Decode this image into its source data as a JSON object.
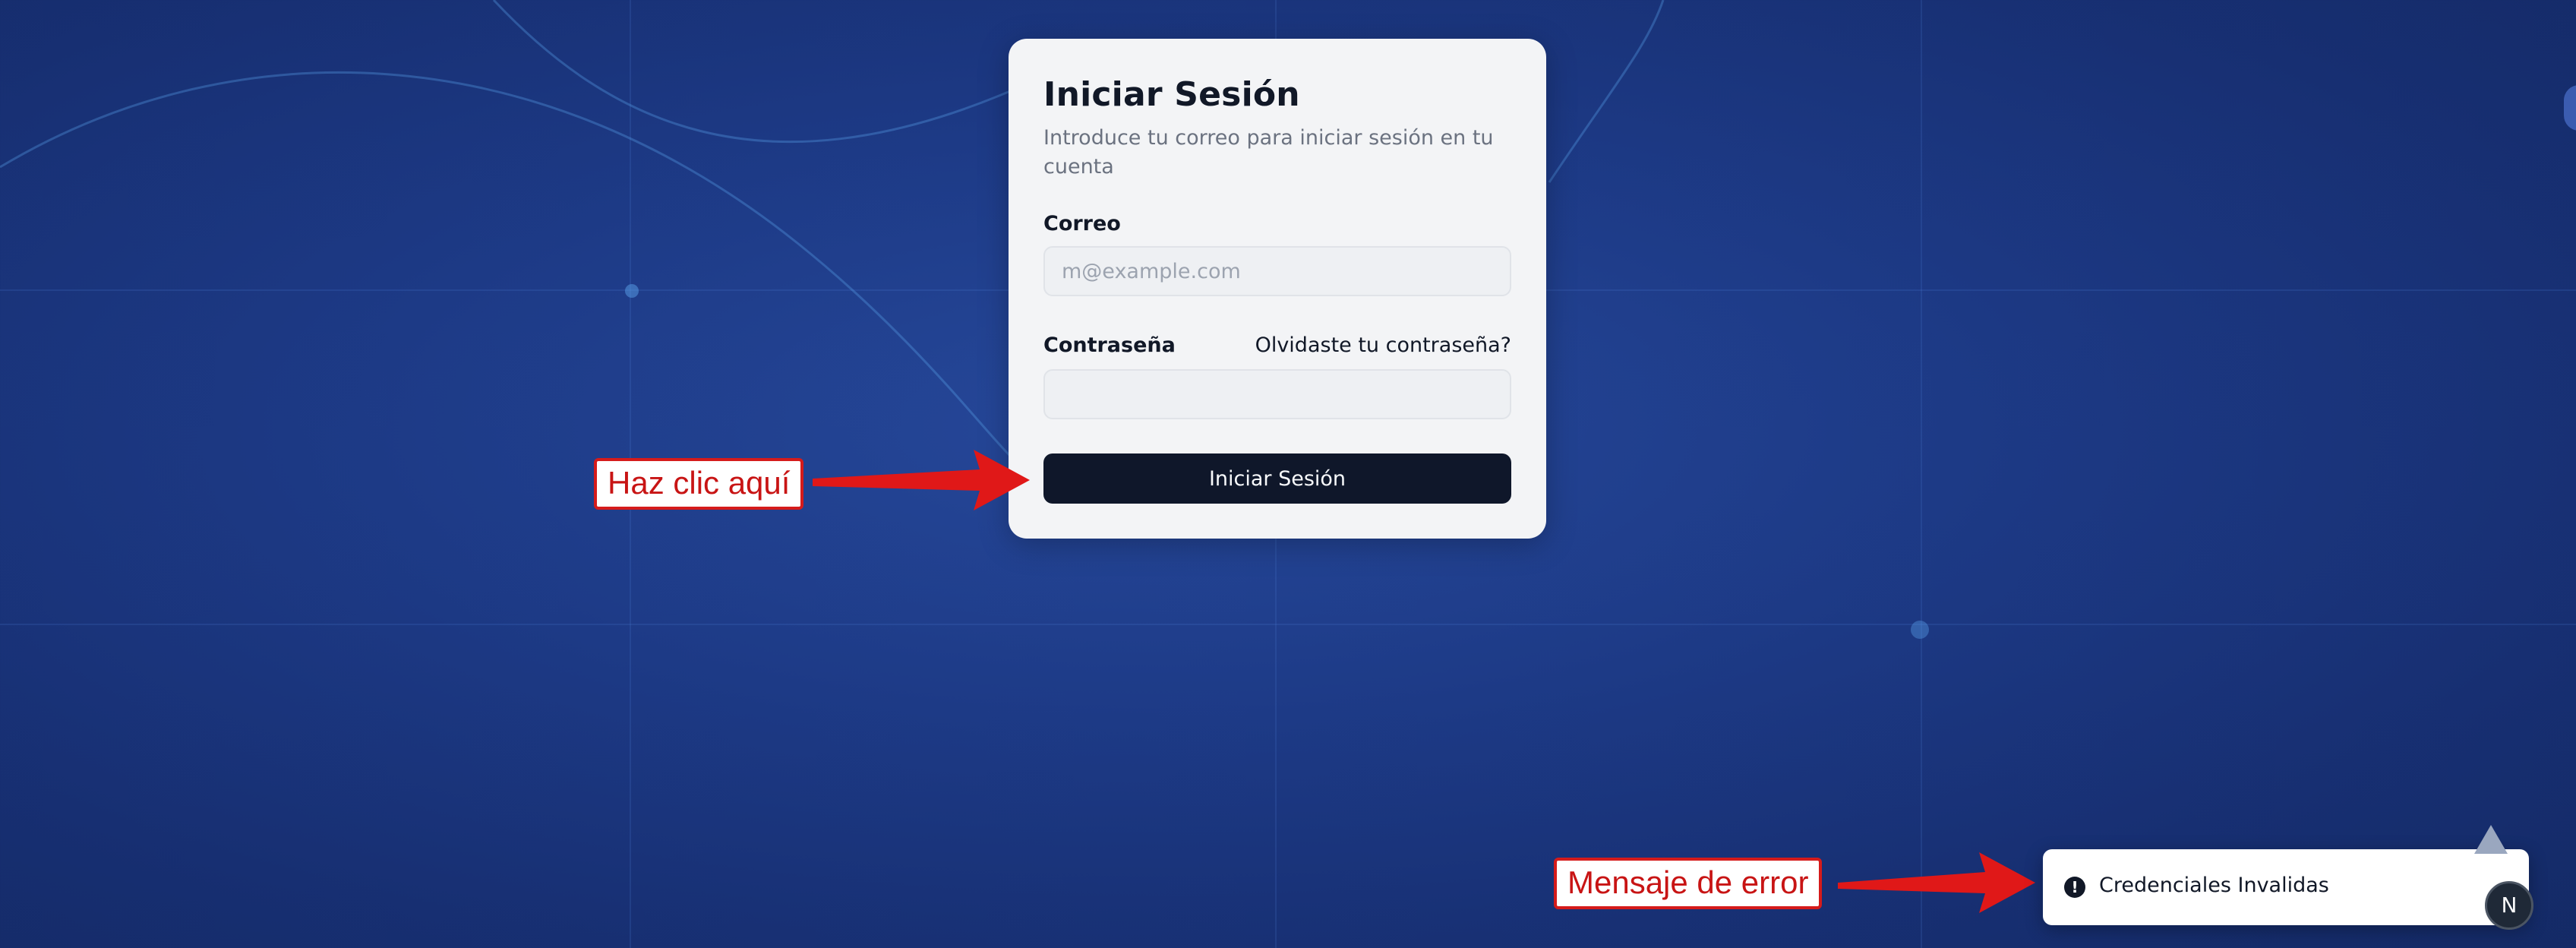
{
  "login": {
    "title": "Iniciar Sesión",
    "subtitle": "Introduce tu correo para iniciar sesión en tu cuenta",
    "email_label": "Correo",
    "email_placeholder": "m@example.com",
    "email_value": "",
    "password_label": "Contraseña",
    "password_value": "",
    "forgot_link": "Olvidaste tu contraseña?",
    "submit_label": "Iniciar Sesión"
  },
  "annotations": {
    "click_here": "Haz clic aquí",
    "error_message": "Mensaje de error"
  },
  "toast": {
    "icon": "alert-circle-icon",
    "message": "Credenciales Invalidas"
  },
  "avatar": {
    "initial": "N"
  },
  "colors": {
    "background": "#1d3a86",
    "card": "#f3f4f6",
    "button": "#0f172a",
    "annotation_red": "#d51b1b"
  }
}
